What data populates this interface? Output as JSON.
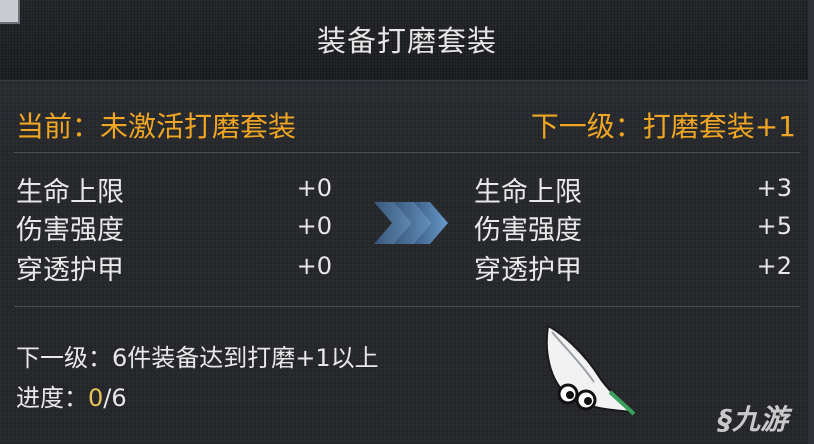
{
  "window": {
    "title": "装备打磨套装"
  },
  "current": {
    "header": "当前：未激活打磨套装",
    "stats": [
      {
        "name": "生命上限",
        "value": "+0"
      },
      {
        "name": "伤害强度",
        "value": "+0"
      },
      {
        "name": "穿透护甲",
        "value": "+0"
      }
    ]
  },
  "next": {
    "header": "下一级：打磨套装+1",
    "stats": [
      {
        "name": "生命上限",
        "value": "+3"
      },
      {
        "name": "伤害强度",
        "value": "+5"
      },
      {
        "name": "穿透护甲",
        "value": "+2"
      }
    ]
  },
  "requirement": {
    "text": "下一级：6件装备达到打磨+1以上"
  },
  "progress": {
    "label": "进度：",
    "current": "0",
    "separator": "/",
    "total": "6"
  },
  "watermark": {
    "brand": "九游",
    "logo_icon": "pea-pod-mascot-logo"
  },
  "colors": {
    "accent_orange": "#f0a622",
    "arrow_blue": "#4f7fb3",
    "text_light": "#e8e8e8"
  }
}
